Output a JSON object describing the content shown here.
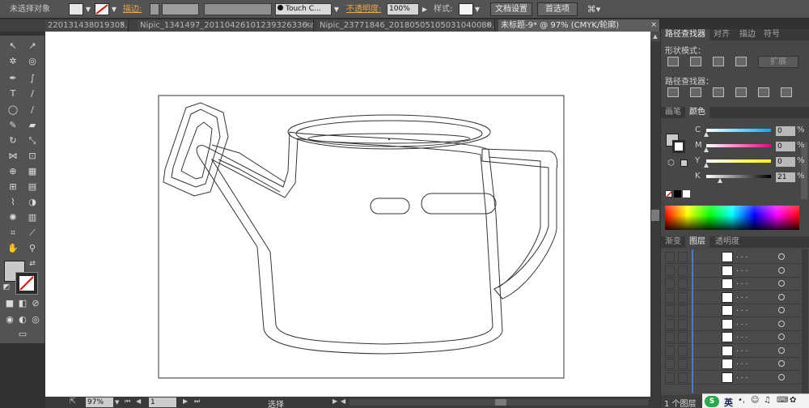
{
  "control_bar": {
    "selection_label": "未选择对象",
    "stroke_label": "描边:",
    "brush_label": "Touch C...",
    "opacity_label": "不透明度:",
    "opacity_value": "100%",
    "style_label": "样式:",
    "doc_setup_button": "文档设置",
    "prefs_button": "首选项"
  },
  "tabs": [
    {
      "label": "220131438019305.ai*"
    },
    {
      "label": "Nipic_1341497_20110426101239326336.ai*"
    },
    {
      "label": "Nipic_23771846_20180505105031040080.ai*"
    },
    {
      "label": "未标题-9* @ 97% (CMYK/轮廓)"
    }
  ],
  "tab_close": "×",
  "status_bar": {
    "zoom": "97%",
    "page": "1",
    "mode": "选择"
  },
  "pathfinder": {
    "tabs": [
      "路径查找器",
      "对齐",
      "描边",
      "符号"
    ],
    "shape_modes_label": "形状模式：",
    "expand_button": "扩展",
    "pathfinders_label": "路径查找器："
  },
  "color_panel": {
    "tabs": [
      "画笔",
      "颜色"
    ],
    "channels": [
      {
        "name": "C",
        "value": "0",
        "unit": "%",
        "level": 0
      },
      {
        "name": "M",
        "value": "0",
        "unit": "%",
        "level": 0
      },
      {
        "name": "Y",
        "value": "0",
        "unit": "%",
        "level": 0
      },
      {
        "name": "K",
        "value": "21",
        "unit": "%",
        "level": 21
      }
    ]
  },
  "layers_panel": {
    "tabs": [
      "渐变",
      "图层",
      "透明度"
    ],
    "row_name": ". . .",
    "row_count": 10,
    "footer": "1 个图层"
  },
  "taskbar": {
    "ime_label": "英"
  },
  "colors": {
    "ui_bg": "#535353",
    "panel_bg": "#474747",
    "accent_orange": "#e9a64b",
    "layer_blue": "#4a78d8",
    "outline_stroke": "#333333"
  }
}
